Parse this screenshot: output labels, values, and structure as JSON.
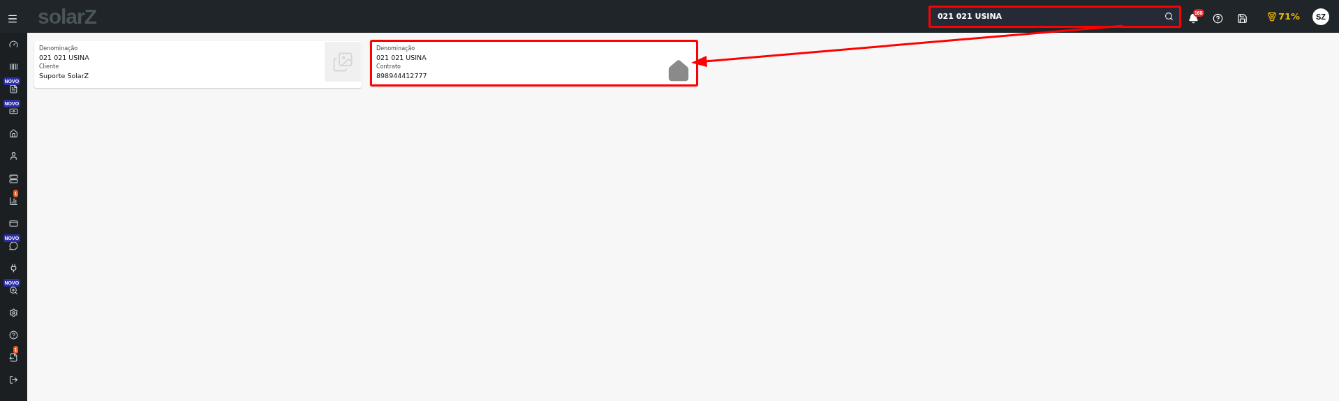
{
  "header": {
    "logo": "solarZ",
    "search": {
      "value": "021 021 USINA",
      "highlighted": true
    },
    "notifications": "168",
    "score": "71%",
    "avatar": "SZ"
  },
  "sidebar": {
    "items": [
      {
        "kind": "plain"
      },
      {
        "kind": "plain"
      },
      {
        "kind": "new",
        "badge": "NOVO"
      },
      {
        "kind": "new",
        "badge": "NOVO"
      },
      {
        "kind": "plain"
      },
      {
        "kind": "plain"
      },
      {
        "kind": "plain"
      },
      {
        "kind": "count",
        "badge": "1"
      },
      {
        "kind": "plain"
      },
      {
        "kind": "new",
        "badge": "NOVO"
      },
      {
        "kind": "plain"
      },
      {
        "kind": "new",
        "badge": "NOVO"
      },
      {
        "kind": "plain"
      },
      {
        "kind": "plain"
      },
      {
        "kind": "count",
        "badge": "1"
      },
      {
        "kind": "plain"
      }
    ]
  },
  "cards": [
    {
      "kind": "photo",
      "highlighted": false,
      "fields": [
        {
          "label": "Denominação",
          "value": "021 021 USINA"
        },
        {
          "label": "Cliente",
          "value": "Suporte SolarZ"
        }
      ]
    },
    {
      "kind": "house",
      "highlighted": true,
      "fields": [
        {
          "label": "Denominação",
          "value": "021 021 USINA"
        },
        {
          "label": "Contrato",
          "value": "898944412777"
        }
      ]
    }
  ]
}
